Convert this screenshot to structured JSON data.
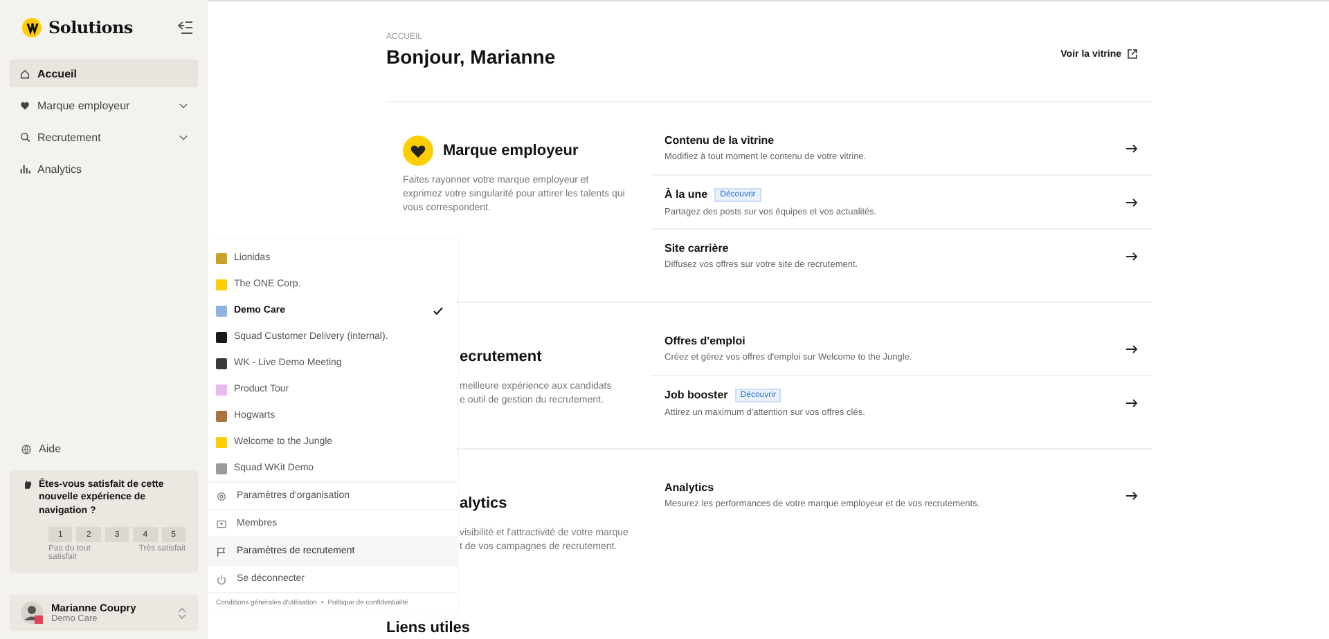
{
  "sidebar": {
    "brand": "Solutions",
    "nav": [
      {
        "label": "Accueil",
        "selected": true,
        "expandable": false
      },
      {
        "label": "Marque employeur",
        "selected": false,
        "expandable": true
      },
      {
        "label": "Recrutement",
        "selected": false,
        "expandable": true
      },
      {
        "label": "Analytics",
        "selected": false,
        "expandable": false
      }
    ],
    "help": "Aide",
    "survey": {
      "question": "Êtes-vous satisfait de cette nouvelle expérience de navigation ?",
      "ratings": [
        "1",
        "2",
        "3",
        "4",
        "5"
      ],
      "low_label": "Pas du tout satisfait",
      "high_label": "Très satisfait"
    },
    "user": {
      "name": "Marianne Coupry",
      "organization": "Demo Care"
    }
  },
  "header": {
    "breadcrumb": "ACCUEIL",
    "title": "Bonjour, Marianne",
    "link": "Voir la vitrine"
  },
  "sections": [
    {
      "kind": "full",
      "title": "Marque employeur",
      "description_lines": [
        "Faites rayonner votre marque employeur et",
        "exprimez votre singularité pour attirer les talents qui",
        "vous correspondent."
      ],
      "items": [
        {
          "title": "Contenu de la vitrine",
          "description": "Modifiez à tout moment le contenu de votre vitrine."
        },
        {
          "title": "À la une",
          "badge": "Découvrir",
          "description": "Partagez des posts sur vos équipes et vos actualités."
        },
        {
          "title": "Site carrière",
          "description": "Diffusez vos offres sur votre site de recrutement."
        }
      ]
    },
    {
      "kind": "covered",
      "title": "ecrutement",
      "description_lines": [
        "meilleure expérience aux candidats",
        "e outil de gestion du recrutement."
      ],
      "items": [
        {
          "title": "Offres d'emploi",
          "description": "Créez et gérez vos offres d'emploi sur Welcome to the Jungle."
        },
        {
          "title": "Job booster",
          "badge": "Découvrir",
          "description": "Attirez un maximum d'attention sur vos offres clés."
        }
      ]
    },
    {
      "kind": "covered",
      "title": "alytics",
      "description_lines": [
        "visibilité et l'attractivité de votre marque",
        "t de vos campagnes de recrutement."
      ],
      "items": [
        {
          "title": "Analytics",
          "description": "Mesurez les performances de votre marque employeur et de vos recrutements."
        }
      ]
    }
  ],
  "next_section_title": "Liens utiles",
  "org_menu": {
    "organizations": [
      {
        "name": "Lionidas",
        "selected": false,
        "color": "#c9a227"
      },
      {
        "name": "The ONE Corp.",
        "selected": false,
        "color": "#ffcd00"
      },
      {
        "name": "Demo Care",
        "selected": true,
        "color": "#8fb3e0"
      },
      {
        "name": "Squad Customer Delivery (internal).",
        "selected": false,
        "color": "#1a1a1a"
      },
      {
        "name": "WK - Live Demo Meeting",
        "selected": false,
        "color": "#3a3a3a"
      },
      {
        "name": "Product Tour",
        "selected": false,
        "color": "#e8b8f0"
      },
      {
        "name": "Hogwarts",
        "selected": false,
        "color": "#a8743a"
      },
      {
        "name": "Welcome to the Jungle",
        "selected": false,
        "color": "#ffcd00"
      },
      {
        "name": "Squad WKit Demo",
        "selected": false,
        "color": "#9a9a9a"
      }
    ],
    "actions": [
      {
        "label": "Paramètres d'organisation",
        "hovered": false
      },
      {
        "label": "Membres",
        "hovered": false
      },
      {
        "label": "Paramètres de recrutement",
        "hovered": true
      },
      {
        "label": "Se déconnecter",
        "hovered": false
      }
    ],
    "footer_separator": "•",
    "footer_links": [
      "Conditions générales d'utilisation",
      "Politique de confidentialité"
    ]
  }
}
